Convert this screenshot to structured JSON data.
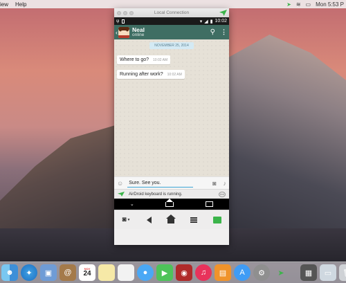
{
  "menubar": {
    "app_menu": "iew",
    "help_menu": "Help",
    "clock": "Mon 5:53 P"
  },
  "window": {
    "title": "Local Connection"
  },
  "android_status": {
    "time": "10:02"
  },
  "chat": {
    "contact_name": "Neal",
    "contact_status": "online",
    "date_chip": "NOVEMBER 25, 2014",
    "messages": [
      {
        "text": "Where to go?",
        "time": "10:02 AM"
      },
      {
        "text": "Running after work?",
        "time": "10:02 AM"
      }
    ],
    "input_value": "Sure. See you.",
    "keyboard_notice": "AirDroid keyboard is running.",
    "keyboard_icon_label": "kbd"
  },
  "dock": {
    "calendar_month": "NOV",
    "calendar_day": "24"
  },
  "icons": {
    "search": "search-icon",
    "wifi": "wifi-icon"
  },
  "colors": {
    "header_green": "#3f6e63",
    "airdroid_green": "#3bb44a",
    "date_chip_bg": "#d4eaf4"
  }
}
